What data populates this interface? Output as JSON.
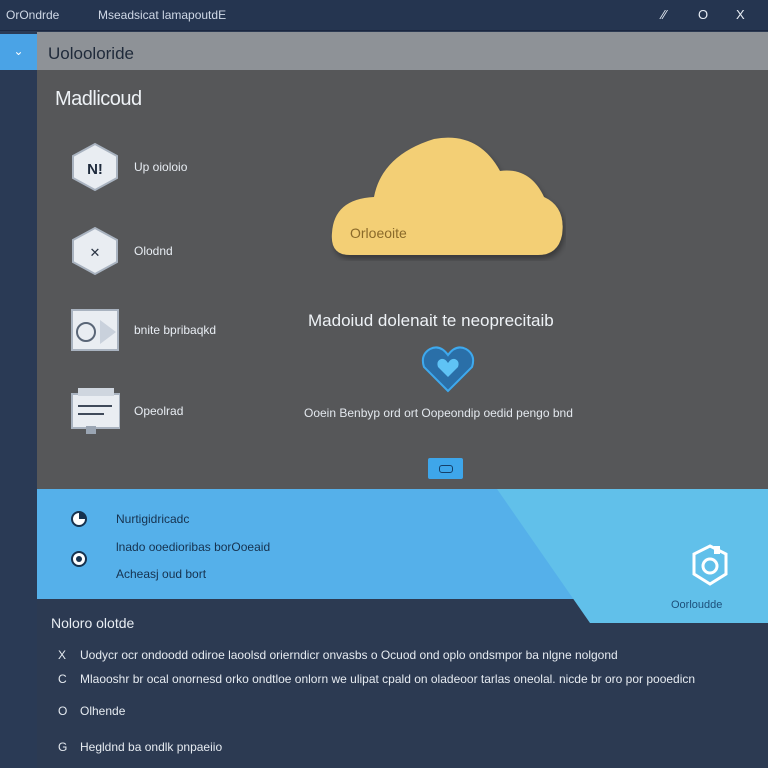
{
  "titlebar": {
    "app_name": "OrOndrde",
    "window_title": "Mseadsicat lamapoutdE",
    "minimize": "⁄⁄",
    "maximize": "O",
    "close": "X"
  },
  "sidebar": {
    "collapse_icon": "chevron-down"
  },
  "header": {
    "title": "Uolooloride"
  },
  "main": {
    "title": "Madlicoud",
    "features": [
      {
        "icon": "user-badge-icon",
        "icon_text": "N!",
        "label": "Up oioloio"
      },
      {
        "icon": "cross-badge-icon",
        "icon_text": "✕",
        "label": "Olodnd"
      },
      {
        "icon": "circle-card-icon",
        "icon_text": "",
        "label": "bnite bpribaqkd"
      },
      {
        "icon": "form-card-icon",
        "icon_text": "",
        "label": "Opeolrad"
      }
    ],
    "cloud_label": "Orloeoite",
    "message": "Madoiud dolenait te neoprecitaib",
    "sub_message": "Ooein Benbyp ord ort Oopeondip oedid pengo bnd"
  },
  "band": {
    "items": [
      {
        "icon": "pie-chart-icon",
        "label": "Nurtigidricadc"
      },
      {
        "icon": "target-icon",
        "label": "lnado ooedioribas borOoeaid"
      },
      {
        "icon": "",
        "label": "Acheasj oud bort"
      }
    ],
    "right_label": "Oorloudde"
  },
  "notes": {
    "title": "Noloro olotde",
    "rows": [
      {
        "icon": "X",
        "text": "Uodycr ocr ondoodd odiroe laoolsd orierndicr onvasbs o Ocuod ond oplo ondsmpor ba nlgne nolgond"
      },
      {
        "icon": "C",
        "text": "Mlaooshr br ocal onornesd orko ondtloe onlorn we ulipat cpald on oladeoor tarlas oneolal. nicde br oro por pooedicn"
      },
      {
        "icon": "O",
        "text": "Olhende"
      },
      {
        "icon": "G",
        "text": "Hegldnd ba ondlk pnpaeiio"
      }
    ]
  },
  "colors": {
    "titlebar": "#253550",
    "sidebar_accent": "#4aa3e6",
    "panel": "#565759",
    "cloud": "#f3cf74",
    "band": "#55b0ea",
    "heart": "#2a6fa8"
  }
}
